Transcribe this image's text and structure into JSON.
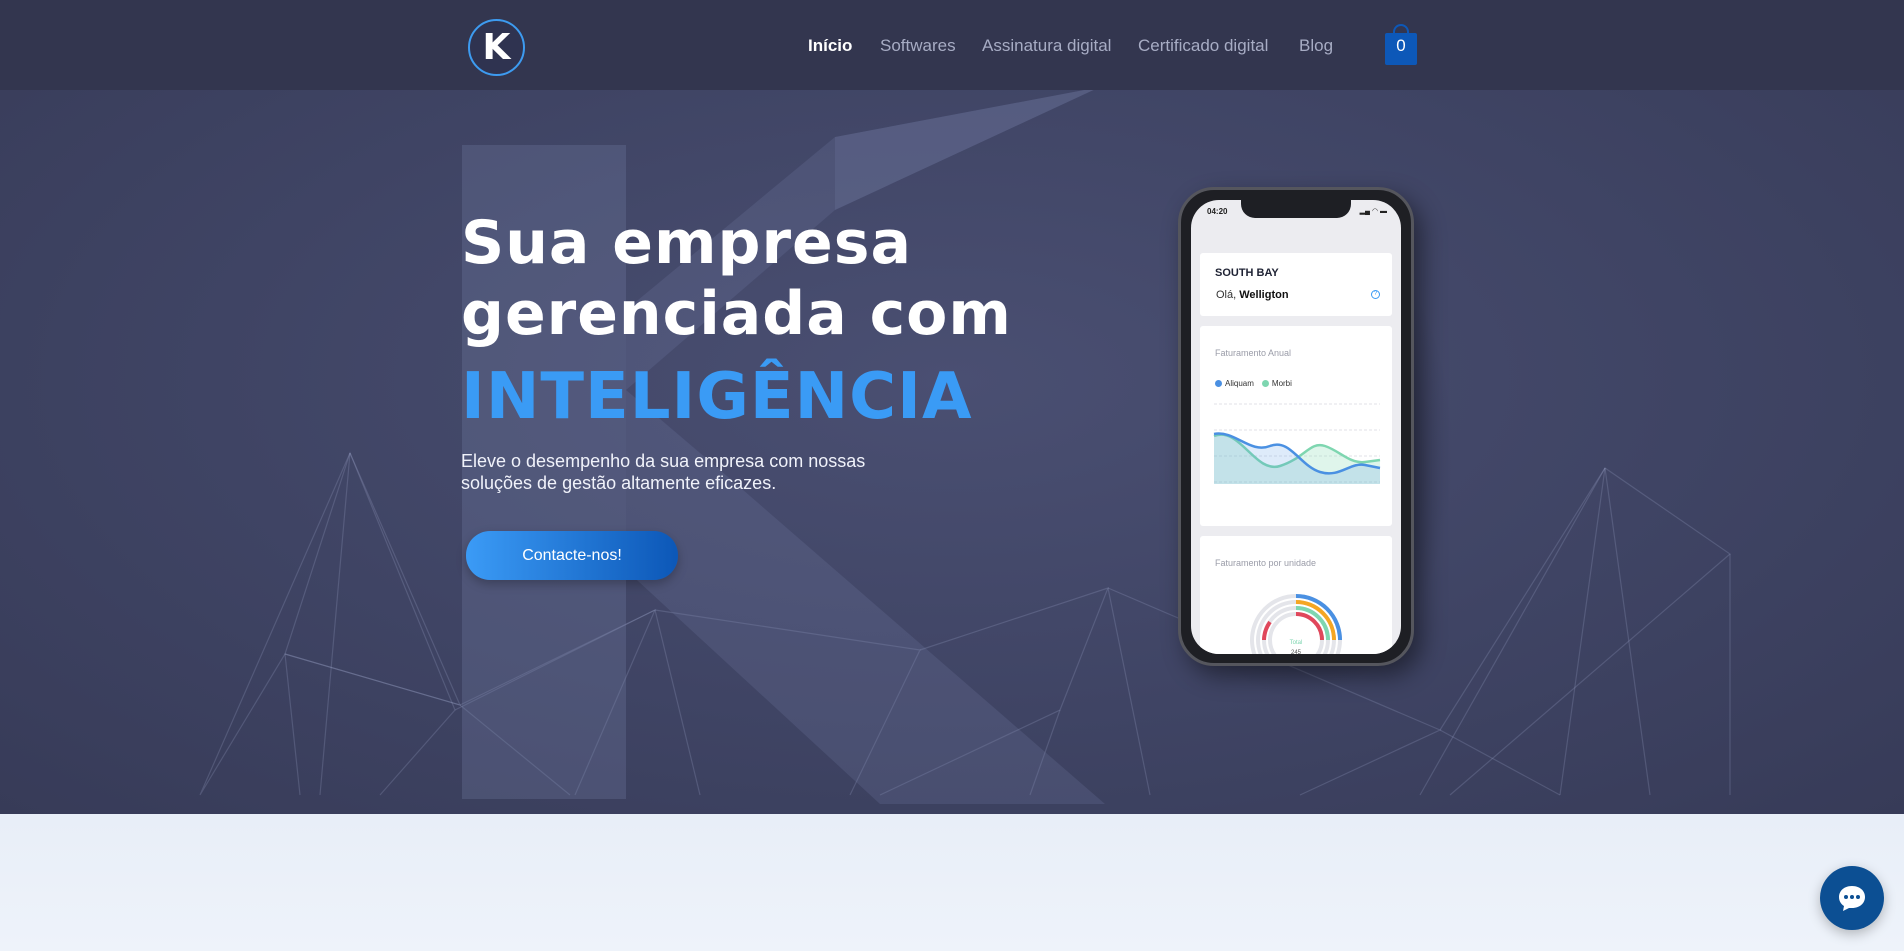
{
  "header": {
    "logo_letter": "K",
    "nav": [
      {
        "label": "Início",
        "active": true
      },
      {
        "label": "Softwares",
        "active": false
      },
      {
        "label": "Assinatura digital",
        "active": false
      },
      {
        "label": "Certificado digital",
        "active": false
      },
      {
        "label": "Blog",
        "active": false
      }
    ],
    "cart_count": "0"
  },
  "hero": {
    "title_line1": "Sua empresa",
    "title_line2": "gerenciada com",
    "title_accent": "INTELIGÊNCIA",
    "subtitle_line1": "Eleve o desempenho da sua empresa com nossas",
    "subtitle_line2": "soluções de gestão altamente eficazes.",
    "cta_label": "Contacte-nos!"
  },
  "phone": {
    "time": "04:20",
    "company": "SOUTH BAY",
    "greeting_prefix": "Olá,",
    "greeting_name": "Welligton",
    "chart1_title": "Faturamento Anual",
    "legend": [
      {
        "name": "Aliquam",
        "color": "#4a90e2"
      },
      {
        "name": "Morbi",
        "color": "#7ed6b0"
      }
    ],
    "chart2_title": "Faturamento por unidade",
    "donut_label": "Total",
    "donut_value": "245"
  },
  "colors": {
    "accent": "#3a9bf5",
    "header_bg": "#33364f",
    "cart": "#0d58b8",
    "chat": "#0c4f93"
  },
  "icons": {
    "cart": "shopping-bag-icon",
    "chat": "chat-bubble-icon",
    "help": "question-icon"
  }
}
